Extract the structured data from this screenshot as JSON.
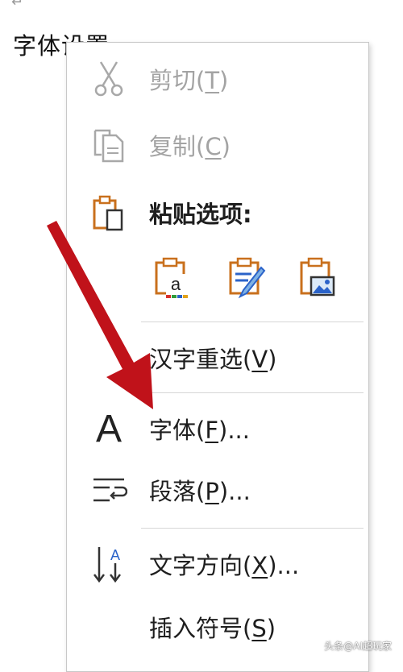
{
  "document": {
    "return_mark": "↵",
    "line_text": "字体设置",
    "paragraph_mark": "↵"
  },
  "context_menu": {
    "cut": {
      "label": "剪切(",
      "key": "T",
      "tail": ")",
      "icon": "scissors-icon",
      "enabled": false
    },
    "copy": {
      "label": "复制(",
      "key": "C",
      "tail": ")",
      "icon": "copy-icon",
      "enabled": false
    },
    "paste_options": {
      "label": "粘贴选项:",
      "icon": "clipboard-icon",
      "options": [
        {
          "icon": "paste-text-only-icon",
          "text": "a"
        },
        {
          "icon": "paste-keep-formatting-icon"
        },
        {
          "icon": "paste-picture-icon"
        }
      ]
    },
    "reconversion": {
      "label": "汉字重选(",
      "key": "V",
      "tail": ")"
    },
    "font": {
      "label": "字体(",
      "key": "F",
      "tail": ")...",
      "icon_glyph": "A",
      "icon": "font-icon"
    },
    "paragraph": {
      "label": "段落(",
      "key": "P",
      "tail": ")...",
      "icon": "paragraph-icon"
    },
    "text_direction": {
      "label": "文字方向(",
      "key": "X",
      "tail": ")...",
      "icon": "text-direction-icon",
      "icon_glyph": "A"
    },
    "insert_symbol": {
      "label": "插入符号(",
      "key": "S",
      "tail": ")"
    }
  },
  "colors": {
    "disabled_text": "#a3a3a3",
    "icon_orange": "#c9701d",
    "arrow_red": "#c0121a"
  },
  "watermark": "头条@AI超玩家"
}
